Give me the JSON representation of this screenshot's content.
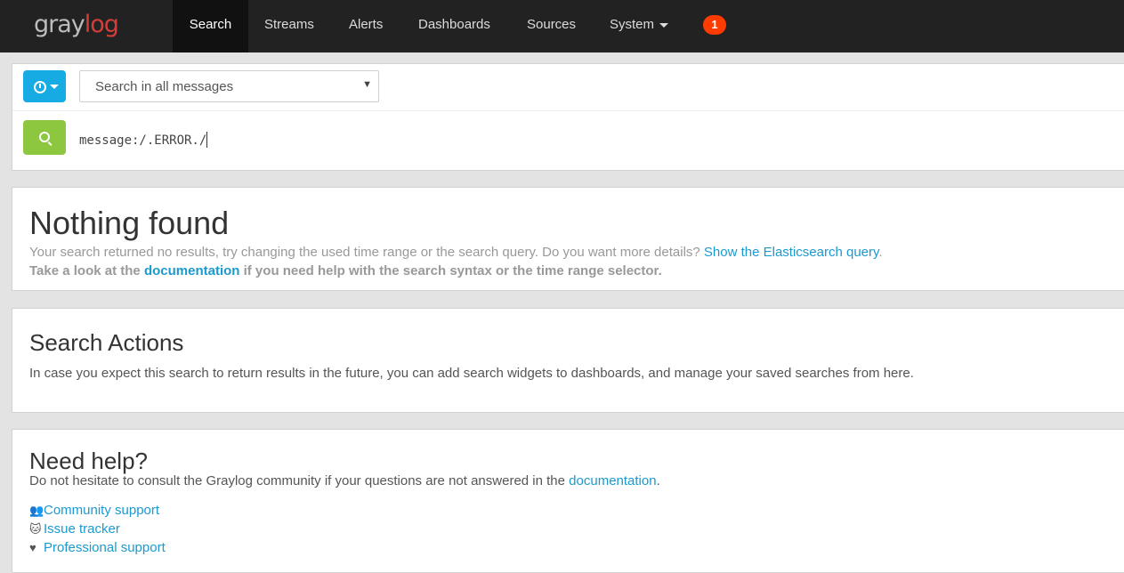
{
  "nav": {
    "logo_gray": "gray",
    "logo_log": "log",
    "items": [
      "Search",
      "Streams",
      "Alerts",
      "Dashboards",
      "Sources",
      "System"
    ],
    "notification_count": "1"
  },
  "search": {
    "stream_placeholder": "Search in all messages",
    "query": "message:/.ERROR./"
  },
  "nothing_found": {
    "title": "Nothing found",
    "line1_text": "Your search returned no results, try changing the used time range or the search query. Do you want more details? ",
    "line1_link": "Show the Elasticsearch query",
    "line1_end": ".",
    "line2_start": "Take a look at the ",
    "line2_link": "documentation",
    "line2_end": " if you need help with the search syntax or the time range selector."
  },
  "actions": {
    "title": "Search Actions",
    "text": "In case you expect this search to return results in the future, you can add search widgets to dashboards, and manage your saved searches from here."
  },
  "help": {
    "title": "Need help?",
    "text": "Do not hesitate to consult the Graylog community if your questions are not answered in the ",
    "text_link": "documentation",
    "text_end": ".",
    "links": [
      "Community support",
      "Issue tracker",
      "Professional support"
    ]
  },
  "colors": {
    "navbar": "#222222",
    "accent_blue": "#16ace3",
    "search_green": "#8dc63f",
    "badge_red": "#ff3b00",
    "link": "#1b9acf"
  },
  "icons": [
    "clock-icon",
    "search-icon",
    "users-icon",
    "github-icon",
    "heart-icon"
  ]
}
